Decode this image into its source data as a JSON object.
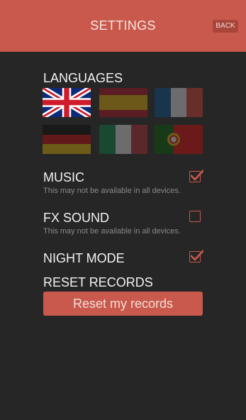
{
  "header": {
    "title": "SETTINGS",
    "back_label": "BACK",
    "background": "#c9594c"
  },
  "languages": {
    "label": "LANGUAGES",
    "flags": [
      {
        "name": "uk-flag",
        "selected": true
      },
      {
        "name": "spain-flag",
        "selected": false
      },
      {
        "name": "france-flag",
        "selected": false
      },
      {
        "name": "germany-flag",
        "selected": false
      },
      {
        "name": "italy-flag",
        "selected": false
      },
      {
        "name": "portugal-flag",
        "selected": false
      }
    ]
  },
  "music": {
    "label": "MUSIC",
    "note": "This may not be available in all devices.",
    "checked": true
  },
  "fx_sound": {
    "label": "FX SOUND",
    "note": "This may not be available in all devices.",
    "checked": false
  },
  "night_mode": {
    "label": "NIGHT MODE",
    "checked": true
  },
  "reset_records": {
    "label": "RESET RECORDS",
    "button_label": "Reset my records"
  },
  "colors": {
    "accent": "#c9594c",
    "background": "#262626"
  }
}
